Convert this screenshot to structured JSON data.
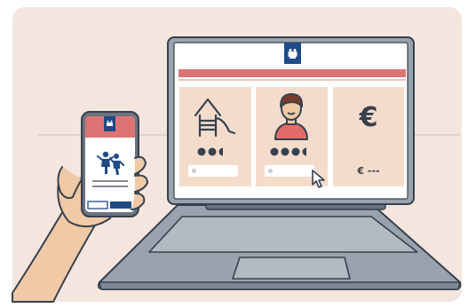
{
  "colors": {
    "background": "#ffffff",
    "panel": "#f4e6df",
    "outline": "#37414d",
    "laptop_body": "#9aa3ad",
    "laptop_dark": "#6b747e",
    "screen_bg": "#ffffff",
    "header_strip": "#dd7474",
    "card_bg": "#f4dccd",
    "accent_navy": "#1f4b86",
    "skin": "#f0c9a6",
    "hair": "#7a3b2c",
    "shirt": "#e26b6b",
    "progress_pill": "#ffffff"
  },
  "laptop": {
    "logo_icon": "coat-of-arms-icon",
    "cards": [
      {
        "icon": "daycare-slide-icon",
        "clock_icons": 3
      },
      {
        "icon": "childminder-person-icon",
        "clock_icons": 4
      },
      {
        "icon": "euro-icon",
        "symbol": "€",
        "price": "€ ---"
      }
    ],
    "cursor_icon": "mouse-pointer-icon"
  },
  "phone": {
    "logo_icon": "coat-of-arms-icon",
    "illustration": "playing-children-icon"
  }
}
